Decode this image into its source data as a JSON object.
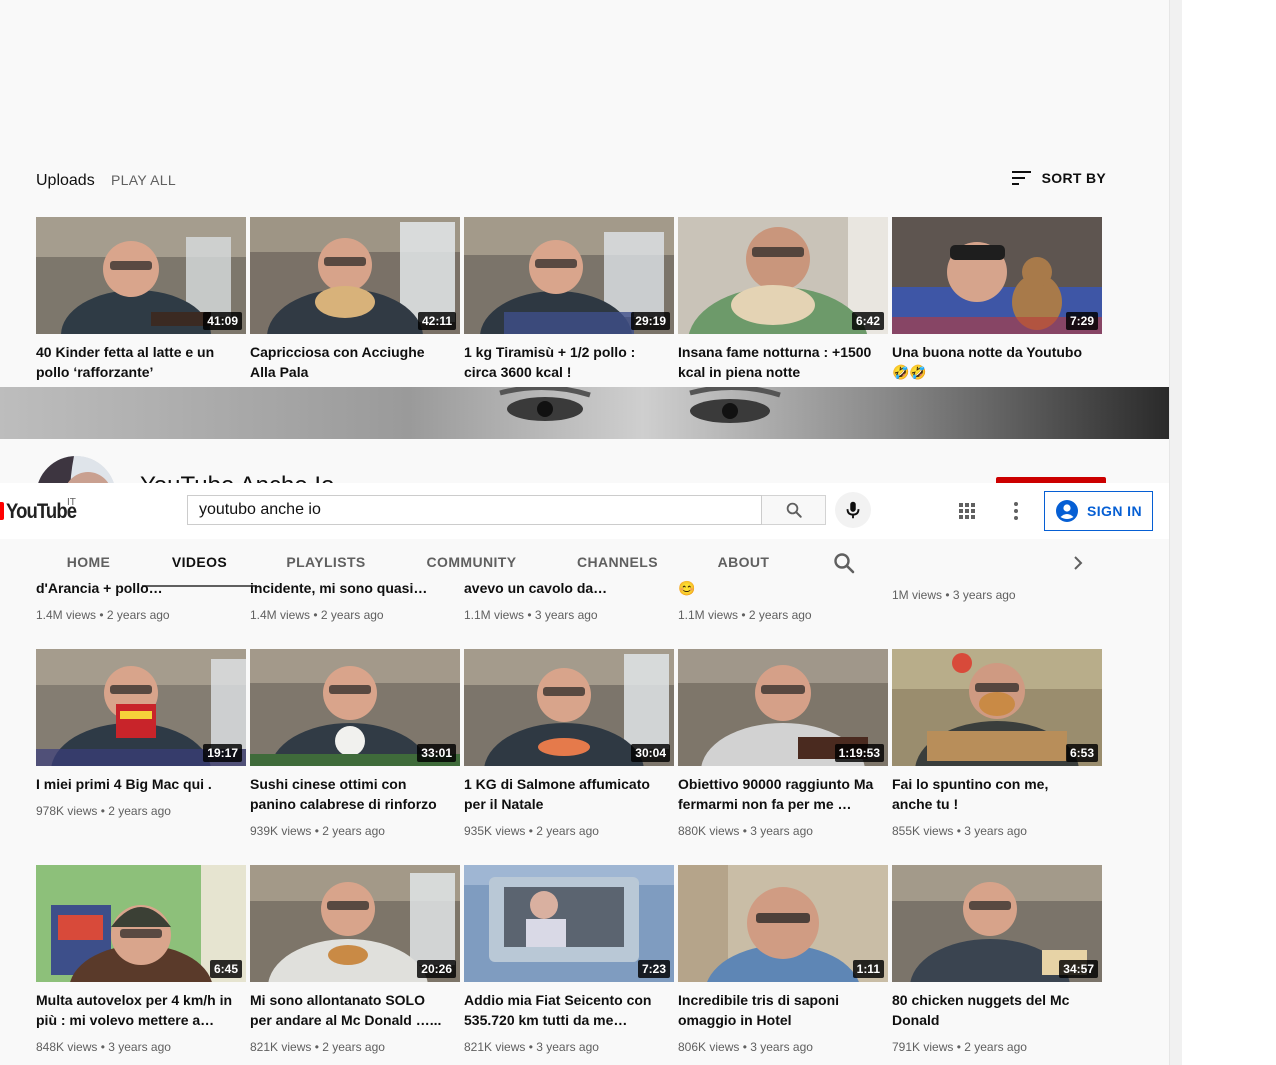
{
  "masthead": {
    "logo_text": "YouTube",
    "country_code": "IT",
    "search_value": "youtubo anche io",
    "signin_label": "SIGN IN",
    "icons": [
      "search-icon",
      "mic-icon",
      "apps-icon",
      "more-vert-icon",
      "account-icon"
    ]
  },
  "channel": {
    "name": "YouTube Anche Io",
    "subscribers": "",
    "subscribe_label": ""
  },
  "tabs": [
    {
      "label": "HOME",
      "active": false
    },
    {
      "label": "VIDEOS",
      "active": true
    },
    {
      "label": "PLAYLISTS",
      "active": false
    },
    {
      "label": "COMMUNITY",
      "active": false
    },
    {
      "label": "CHANNELS",
      "active": false
    },
    {
      "label": "ABOUT",
      "active": false
    }
  ],
  "shelf": {
    "title": "Uploads",
    "play_all": "PLAY ALL",
    "sort_by": "SORT BY"
  },
  "videos": [
    {
      "title": "40 Kinder fetta al latte e un pollo ‘rafforzante’",
      "duration": "41:09"
    },
    {
      "title": "Capricciosa con Acciughe Alla Pala",
      "duration": "42:11"
    },
    {
      "title": "1 kg Tiramisù + 1/2 pollo : circa 3600 kcal !",
      "duration": "29:19"
    },
    {
      "title": "Insana fame notturna : +1500 kcal in piena notte",
      "duration": "6:42"
    },
    {
      "title": "Una buona notte da Youtubo 🤣🤣",
      "duration": "7:29"
    },
    {
      "title": "d'Arancia + pollo…",
      "meta": "1.4M views • 2 years ago"
    },
    {
      "title": "incidente, mi sono quasi…",
      "meta": "1.4M views • 2 years ago"
    },
    {
      "title": "avevo un cavolo da…",
      "meta": "1.1M views • 3 years ago"
    },
    {
      "title": "😊",
      "meta": "1.1M views • 2 years ago"
    },
    {
      "title": "",
      "meta": "1M views • 3 years ago"
    },
    {
      "title": "I miei primi 4 Big Mac qui .",
      "duration": "19:17",
      "meta": "978K views • 2 years ago"
    },
    {
      "title": "Sushi cinese ottimi con panino calabrese di rinforzo",
      "duration": "33:01",
      "meta": "939K views • 2 years ago"
    },
    {
      "title": "1 KG di Salmone affumicato per il Natale",
      "duration": "30:04",
      "meta": "935K views • 2 years ago"
    },
    {
      "title": "Obiettivo 90000 raggiunto Ma fermarmi non fa per me …",
      "duration": "1:19:53",
      "meta": "880K views • 3 years ago"
    },
    {
      "title": "Fai lo spuntino con me, anche tu !",
      "duration": "6:53",
      "meta": "855K views • 3 years ago"
    },
    {
      "title": "Multa autovelox per 4 km/h in più : mi volevo mettere a…",
      "duration": "6:45",
      "meta": "848K views • 3 years ago"
    },
    {
      "title": "Mi sono allontanato SOLO per andare al Mc Donald …...",
      "duration": "20:26",
      "meta": "821K views • 2 years ago"
    },
    {
      "title": "Addio mia Fiat Seicento con 535.720 km tutti da me…",
      "duration": "7:23",
      "meta": "821K views • 3 years ago"
    },
    {
      "title": "Incredibile tris di saponi omaggio in Hotel",
      "duration": "1:11",
      "meta": "806K views • 3 years ago"
    },
    {
      "title": "80 chicken nuggets del Mc Donald",
      "duration": "34:57",
      "meta": "791K views • 2 years ago"
    }
  ],
  "thumb_colors": {
    "kitchen": "#8a8478",
    "shirt": "#2f3b45",
    "skin": "#d9a58c",
    "green_room": "#7aa86a",
    "bed": "#4a5a8a",
    "car": "#6f8fb3"
  }
}
